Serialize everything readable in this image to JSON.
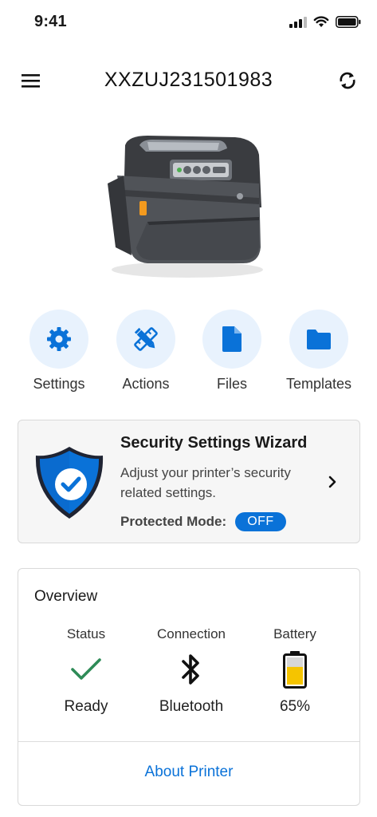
{
  "status_bar": {
    "time": "9:41"
  },
  "header": {
    "title": "XXZUJ231501983",
    "menu_icon": "hamburger-menu-icon",
    "refresh_icon": "refresh-icon"
  },
  "quick_actions": [
    {
      "label": "Settings",
      "icon": "gear-icon"
    },
    {
      "label": "Actions",
      "icon": "pencil-ruler-icon"
    },
    {
      "label": "Files",
      "icon": "file-icon"
    },
    {
      "label": "Templates",
      "icon": "folder-icon"
    }
  ],
  "security": {
    "title": "Security Settings Wizard",
    "description": "Adjust your printer’s security related settings.",
    "protected_label": "Protected Mode:",
    "protected_value": "OFF"
  },
  "overview": {
    "title": "Overview",
    "status": {
      "label": "Status",
      "value": "Ready"
    },
    "connection": {
      "label": "Connection",
      "value": "Bluetooth"
    },
    "battery": {
      "label": "Battery",
      "value": "65%",
      "level": 0.65
    },
    "about_link": "About Printer"
  },
  "colors": {
    "accent": "#0a72d8",
    "icon_bg": "#e8f2fd",
    "ready_green": "#2e8b57",
    "battery_yellow": "#f5c400"
  }
}
